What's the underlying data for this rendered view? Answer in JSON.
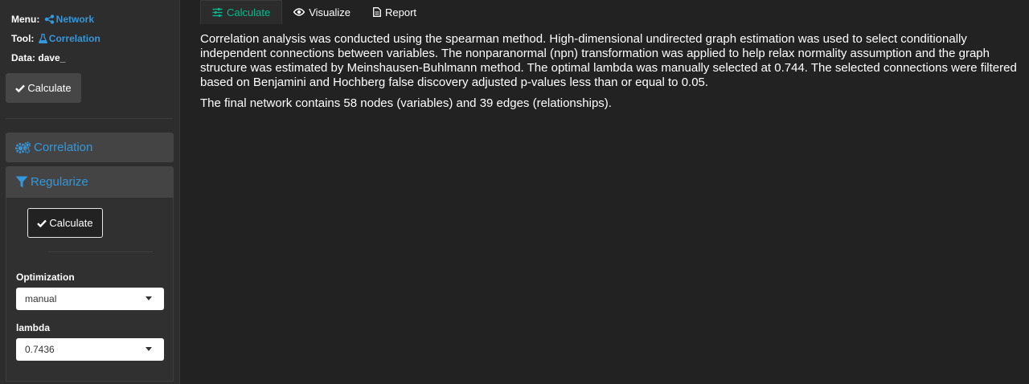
{
  "sidebar": {
    "menu_label": "Menu:",
    "menu_value": "Network",
    "tool_label": "Tool:",
    "tool_value": "Correlation",
    "data_label": "Data:",
    "data_value": "dave_",
    "calculate_label": "Calculate",
    "panels": [
      {
        "label": "Correlation",
        "icon": "gears-icon"
      },
      {
        "label": "Regularize",
        "icon": "filter-icon"
      }
    ],
    "regularize": {
      "calculate_label": "Calculate",
      "optimization_label": "Optimization",
      "optimization_value": "manual",
      "lambda_label": "lambda",
      "lambda_value": "0.7436"
    }
  },
  "tabs": [
    {
      "label": "Calculate",
      "icon": "sliders-icon",
      "active": true
    },
    {
      "label": "Visualize",
      "icon": "eye-icon",
      "active": false
    },
    {
      "label": "Report",
      "icon": "file-icon",
      "active": false
    }
  ],
  "content": {
    "paragraph1": "Correlation analysis was conducted using the spearman method. High-dimensional undirected graph estimation was used to select conditionally independent connections between variables. The nonparanormal (npn) transformation was applied to help relax normality assumption and the graph structure was estimated by Meinshausen-Buhlmann method. The optimal lambda was manually selected at 0.744. The selected connections were filtered based on Benjamini and Hochberg false discovery adjusted p-values less than or equal to 0.05.",
    "paragraph2": "The final network contains 58 nodes (variables) and 39 edges (relationships)."
  },
  "colors": {
    "accent_blue": "#3498db",
    "accent_green": "#00bc8c",
    "background": "#222222",
    "sidebar": "#2d2d2d"
  }
}
